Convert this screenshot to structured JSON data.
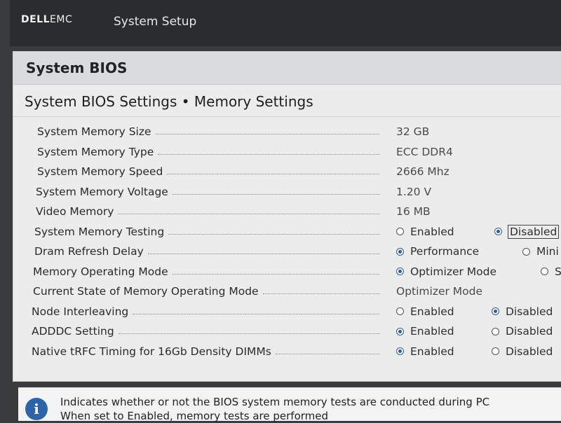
{
  "header": {
    "logo_brand": "DELL",
    "logo_suffix": "EMC",
    "app_title": "System Setup"
  },
  "panel": {
    "title": "System BIOS",
    "section_title": "System BIOS Settings • Memory Settings"
  },
  "settings": [
    {
      "label": "System Memory Size",
      "value": "32 GB"
    },
    {
      "label": "System Memory Type",
      "value": "ECC DDR4"
    },
    {
      "label": "System Memory Speed",
      "value": "2666 Mhz"
    },
    {
      "label": "System Memory Voltage",
      "value": "1.20 V"
    },
    {
      "label": "Video Memory",
      "value": "16 MB"
    },
    {
      "label": "System Memory Testing",
      "options": [
        {
          "label": "Enabled",
          "selected": false
        },
        {
          "label": "Disabled",
          "selected": true,
          "focused": true
        }
      ]
    },
    {
      "label": "Dram Refresh Delay",
      "options": [
        {
          "label": "Performance",
          "selected": true
        },
        {
          "label": "Mini",
          "selected": false
        }
      ]
    },
    {
      "label": "Memory Operating Mode",
      "options": [
        {
          "label": "Optimizer Mode",
          "selected": true
        },
        {
          "label": "S",
          "selected": false
        }
      ]
    },
    {
      "label": "Current State of Memory Operating Mode",
      "value": "Optimizer Mode"
    },
    {
      "label": "Node Interleaving",
      "options": [
        {
          "label": "Enabled",
          "selected": false
        },
        {
          "label": "Disabled",
          "selected": true
        }
      ]
    },
    {
      "label": "ADDDC Setting",
      "options": [
        {
          "label": "Enabled",
          "selected": true
        },
        {
          "label": "Disabled",
          "selected": false
        }
      ]
    },
    {
      "label": "Native tRFC Timing for 16Gb Density DIMMs",
      "options": [
        {
          "label": "Enabled",
          "selected": true
        },
        {
          "label": "Disabled",
          "selected": false
        }
      ]
    }
  ],
  "help": {
    "icon": "info-icon",
    "line1": "Indicates whether or not the BIOS system memory tests are conducted during PC",
    "line2": "When set to Enabled, memory tests are performed"
  },
  "colors": {
    "accent": "#2d5c9b",
    "topbar": "#2b2c2e",
    "panel_bg": "#ececec"
  }
}
